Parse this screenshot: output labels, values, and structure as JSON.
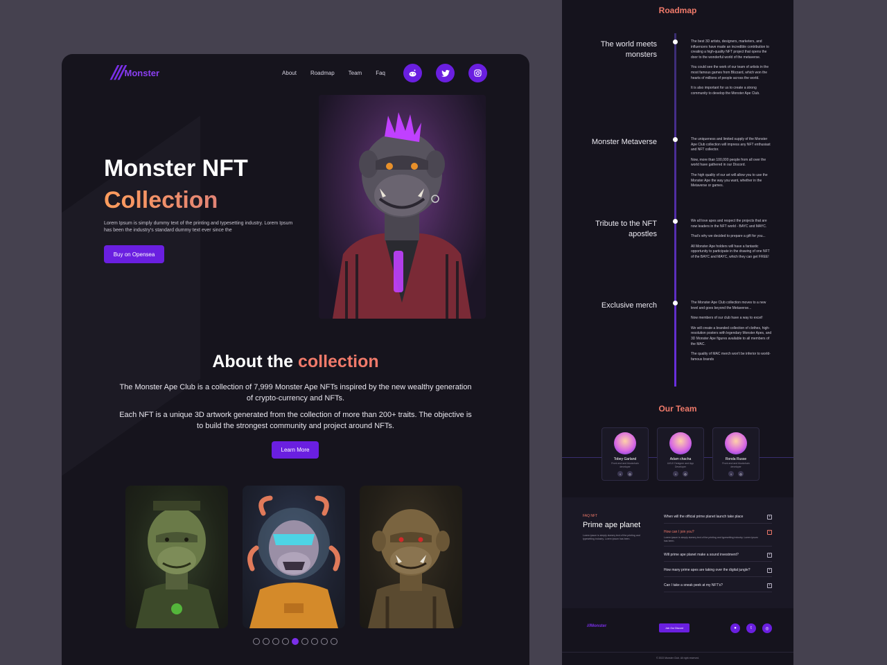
{
  "brand": {
    "name": "Monster"
  },
  "nav": {
    "about": "About",
    "roadmap": "Roadmap",
    "team": "Team",
    "faq": "Faq"
  },
  "social": {
    "reddit": "reddit-icon",
    "twitter": "twitter-icon",
    "instagram": "instagram-icon"
  },
  "hero": {
    "title_line1": "Monster NFT",
    "title_line2": "Collection",
    "description": "Lorem Ipsum is simply dummy text of the printing and typesetting industry. Lorem Ipsum has been the industry's standard dummy text ever since the",
    "cta": "Buy on Opensea"
  },
  "about": {
    "title_plain": "About the",
    "title_highlight": "collection",
    "paragraph1": "The Monster Ape Club is a collection of 7,999 Monster Ape NFTs inspired by the new wealthy generation of crypto-currency and NFTs.",
    "paragraph2": "Each NFT is a unique 3D artwork generated from the collection of more than 200+ traits. The objective is to build the strongest community and project around NFTs.",
    "cta": "Learn More"
  },
  "carousel": {
    "total": 9,
    "active_index": 4
  },
  "roadmap": {
    "title": "Roadmap",
    "items": [
      {
        "heading": "The world meets monsters",
        "paragraphs": [
          "The best 3D artists, designers, marketers, and influencers have made an incredible contribution to creating a high-quality NFT project that opens the door to the wonderful world of the metaverse.",
          "You could see the work of our team of artists in the most famous games from Blizzard, which won the hearts of millions of people across the world.",
          "It is also important for us to create a strong community to develop the Monster Ape Club."
        ]
      },
      {
        "heading": "Monster Metaverse",
        "paragraphs": [
          "The uniqueness and limited supply of the Monster Ape Club collection will impress any NFT enthusiast and NFT collector.",
          "Now, more than 100,000 people from all over the world have gathered in our Discord.",
          "The high quality of our art will allow you to use the Monster Ape the way you want, whether in the Metaverse or games."
        ]
      },
      {
        "heading": "Tribute to the NFT apostles",
        "paragraphs": [
          "We all love apes and respect the projects that are now leaders in the NFT world - BAYC and MAYC.",
          "That's why we decided to prepare a gift for you...",
          "All Monster Ape holders will have a fantastic opportunity to participate in the drawing of one NFT of the BAYC and MAYC, which they can get FREE!"
        ]
      },
      {
        "heading": "Exclusive merch",
        "paragraphs": [
          "The Monster Ape Club collection moves to a new level and goes beyond the Metaverse...",
          "Now members of our club have a way to excel!",
          "We will create a branded collection of clothes, high-resolution posters with legendary Monster Apes, and 3D Monster Ape figures available to all members of the MAC.",
          "The quality of MAC merch won't be inferior to world-famous brands"
        ]
      }
    ]
  },
  "team": {
    "title": "Our Team",
    "members": [
      {
        "name": "Tobey Garland",
        "role": "Front-end and blockchain developer"
      },
      {
        "name": "Adam chacha",
        "role": "UI/UX Designer and App Developer"
      },
      {
        "name": "Ronda Russe",
        "role": "Front-end and blockchain developer"
      }
    ]
  },
  "faq": {
    "tag": "FAQ NFT",
    "title": "Prime ape planet",
    "description": "Lorem ipsum is simply dummy text of the printing and typesetting industry. Lorem ipsum has been.",
    "questions": [
      {
        "q": "When will the official prime planet launch take place",
        "open": false,
        "answer": ""
      },
      {
        "q": "How can I join you?",
        "open": true,
        "answer": "Lorem ipsum is simply dummy text of the printing and typesetting industry. Lorem ipsum has been."
      },
      {
        "q": "Will prime ape planet make a sound investment?",
        "open": false,
        "answer": ""
      },
      {
        "q": "How many prime apes are taking over the digital jungle?",
        "open": false,
        "answer": ""
      },
      {
        "q": "Can I take a sneak peek at my NFT's?",
        "open": false,
        "answer": ""
      }
    ]
  },
  "footer": {
    "logo": "Monster",
    "cta": "Join Our Discord",
    "copyright": "© 2022 Monster Club. All right reserved."
  },
  "colors": {
    "accent": "#6a1fe0",
    "highlight": "#f07a6a",
    "background": "#16141d",
    "canvas": "#45414f"
  }
}
